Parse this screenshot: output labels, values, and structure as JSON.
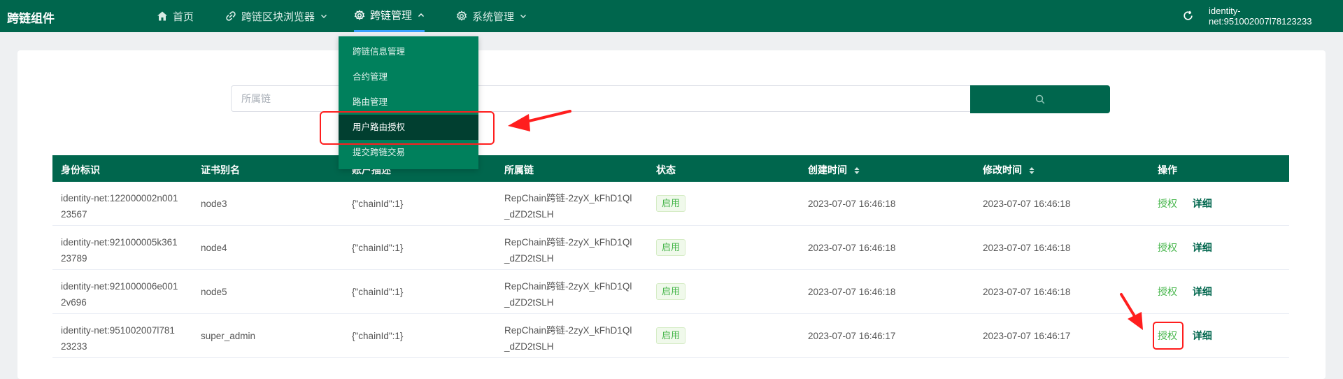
{
  "app": {
    "title": "跨链组件"
  },
  "nav": {
    "home": "首页",
    "browser": "跨链区块浏览器",
    "manage": "跨链管理",
    "system": "系统管理"
  },
  "header": {
    "identity": "identity-net:951002007l78123233"
  },
  "dropdown": {
    "items": [
      "跨链信息管理",
      "合约管理",
      "路由管理",
      "用户路由授权",
      "提交跨链交易"
    ],
    "selected_index": 3
  },
  "search": {
    "placeholder": "所属链"
  },
  "table": {
    "headers": [
      "身份标识",
      "证书别名",
      "账户描述",
      "所属链",
      "状态",
      "创建时间",
      "修改时间",
      "操作"
    ],
    "rows": [
      {
        "id_line1": "identity-net:122000002n001",
        "id_line2": "23567",
        "alias": "node3",
        "desc": "{\"chainId\":1}",
        "chain_line1": "RepChain跨链-2zyX_kFhD1Ql",
        "chain_line2": "_dZD2tSLH",
        "status": "启用",
        "created": "2023-07-07 16:46:18",
        "modified": "2023-07-07 16:46:18",
        "op_auth": "授权",
        "op_detail": "详细"
      },
      {
        "id_line1": "identity-net:921000005k361",
        "id_line2": "23789",
        "alias": "node4",
        "desc": "{\"chainId\":1}",
        "chain_line1": "RepChain跨链-2zyX_kFhD1Ql",
        "chain_line2": "_dZD2tSLH",
        "status": "启用",
        "created": "2023-07-07 16:46:18",
        "modified": "2023-07-07 16:46:18",
        "op_auth": "授权",
        "op_detail": "详细"
      },
      {
        "id_line1": "identity-net:921000006e001",
        "id_line2": "2v696",
        "alias": "node5",
        "desc": "{\"chainId\":1}",
        "chain_line1": "RepChain跨链-2zyX_kFhD1Ql",
        "chain_line2": "_dZD2tSLH",
        "status": "启用",
        "created": "2023-07-07 16:46:18",
        "modified": "2023-07-07 16:46:18",
        "op_auth": "授权",
        "op_detail": "详细"
      },
      {
        "id_line1": "identity-net:951002007l781",
        "id_line2": "23233",
        "alias": "super_admin",
        "desc": "{\"chainId\":1}",
        "chain_line1": "RepChain跨链-2zyX_kFhD1Ql",
        "chain_line2": "_dZD2tSLH",
        "status": "启用",
        "created": "2023-07-07 16:46:17",
        "modified": "2023-07-07 16:46:17",
        "op_auth": "授权",
        "op_detail": "详细"
      }
    ]
  },
  "colors": {
    "brand": "#00664d",
    "menu_bg": "#00805c",
    "menu_selected": "#013f30",
    "status_green": "#44b549",
    "highlight_red": "#ff1e1e"
  },
  "icons": [
    "home-icon",
    "link-icon",
    "gear-icon",
    "chevron-down-icon",
    "chevron-up-icon",
    "refresh-icon",
    "search-icon",
    "sort-icon"
  ]
}
